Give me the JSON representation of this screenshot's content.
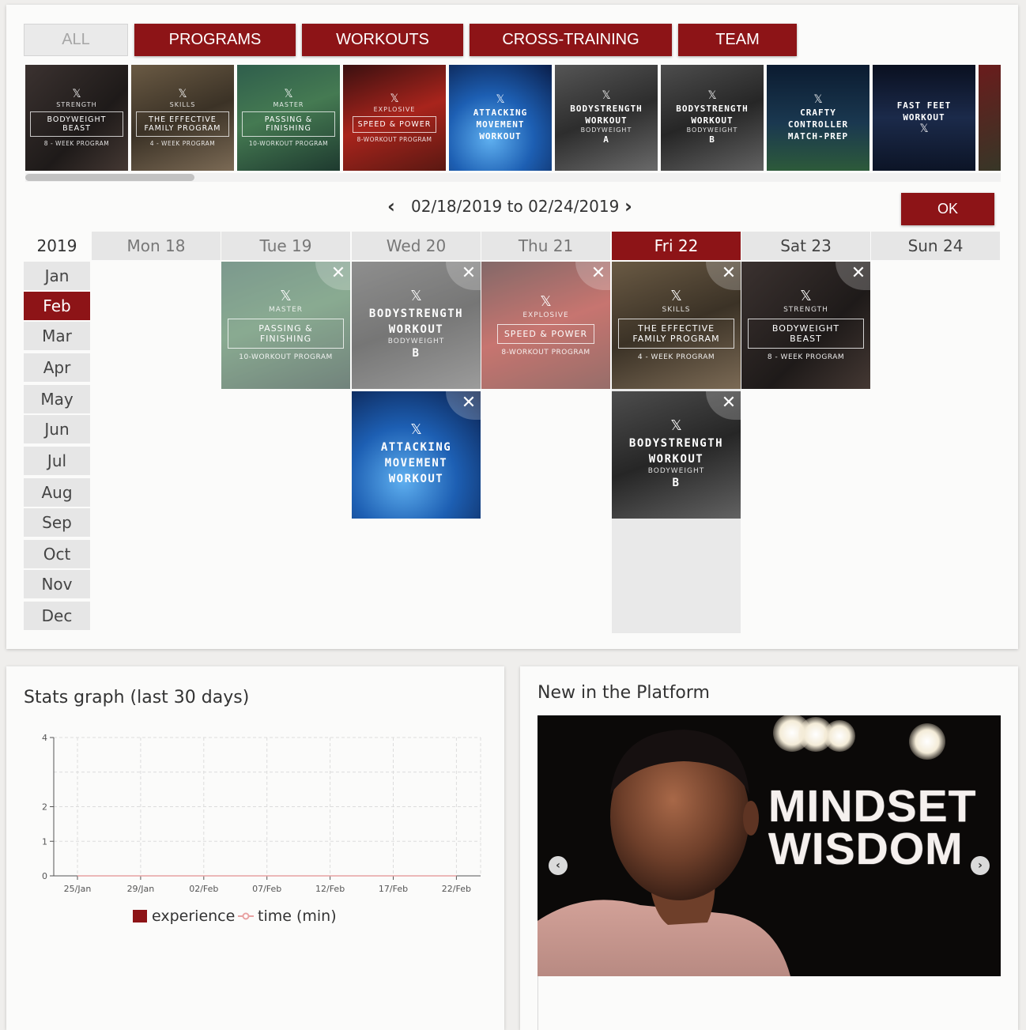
{
  "filters": {
    "all": "ALL",
    "programs": "PROGRAMS",
    "workouts": "WORKOUTS",
    "cross_training": "CROSS-TRAINING",
    "team": "TEAM"
  },
  "carousel": [
    {
      "kicker": "STRENGTH",
      "title": "BODYWEIGHT BEAST",
      "sub": "8 - WEEK PROGRAM"
    },
    {
      "kicker": "SKILLS",
      "title": "THE EFFECTIVE FAMILY PROGRAM",
      "sub": "4 - WEEK PROGRAM"
    },
    {
      "kicker": "MASTER",
      "title": "PASSING & FINISHING",
      "sub": "10-WORKOUT PROGRAM"
    },
    {
      "kicker": "EXPLOSIVE",
      "title": "SPEED & POWER",
      "sub": "8-WORKOUT PROGRAM"
    },
    {
      "title": "ATTACKING MOVEMENT WORKOUT"
    },
    {
      "title": "BODYSTRENGTH WORKOUT",
      "kicker": "BODYWEIGHT",
      "sub": "A"
    },
    {
      "title": "BODYSTRENGTH WORKOUT",
      "kicker": "BODYWEIGHT",
      "sub": "B"
    },
    {
      "title": "CRAFTY CONTROLLER MATCH-PREP"
    },
    {
      "title": "FAST FEET WORKOUT"
    }
  ],
  "week": {
    "range": "02/18/2019 to 02/24/2019",
    "ok": "OK"
  },
  "calendar": {
    "year": "2019",
    "months": [
      "Jan",
      "Feb",
      "Mar",
      "Apr",
      "May",
      "Jun",
      "Jul",
      "Aug",
      "Sep",
      "Oct",
      "Nov",
      "Dec"
    ],
    "active_month": "Feb",
    "days": [
      "Mon 18",
      "Tue 19",
      "Wed 20",
      "Thu 21",
      "Fri 22",
      "Sat 23",
      "Sun 24"
    ],
    "active_day": "Fri 22"
  },
  "schedule": {
    "tue": {
      "kicker": "MASTER",
      "title": "PASSING & FINISHING",
      "sub": "10-WORKOUT PROGRAM"
    },
    "wed1": {
      "title": "BODYSTRENGTH WORKOUT",
      "kicker": "BODYWEIGHT",
      "sub": "B"
    },
    "wed2": {
      "title": "ATTACKING MOVEMENT WORKOUT"
    },
    "thu": {
      "kicker": "EXPLOSIVE",
      "title": "SPEED & POWER",
      "sub": "8-WORKOUT PROGRAM"
    },
    "fri1": {
      "kicker": "SKILLS",
      "title": "THE EFFECTIVE FAMILY PROGRAM",
      "sub": "4 - WEEK PROGRAM"
    },
    "fri2": {
      "title": "BODYSTRENGTH WORKOUT",
      "kicker": "BODYWEIGHT",
      "sub": "B"
    },
    "sat": {
      "kicker": "STRENGTH",
      "title": "BODYWEIGHT BEAST",
      "sub": "8 - WEEK PROGRAM"
    },
    "close_glyph": "✕"
  },
  "stats": {
    "title": "Stats graph (last 30 days)",
    "legend": {
      "experience": "experience",
      "time": "time (min)"
    }
  },
  "chart_data": {
    "type": "line",
    "title": "Stats graph (last 30 days)",
    "x_tick_labels": [
      "25/Jan",
      "29/Jan",
      "02/Feb",
      "07/Feb",
      "12/Feb",
      "17/Feb",
      "22/Feb"
    ],
    "y_ticks": [
      0,
      1,
      2,
      4
    ],
    "ylim": [
      0,
      4
    ],
    "grid": true,
    "legend_position": "bottom",
    "series": [
      {
        "name": "experience",
        "type": "bar",
        "color": "#8d1417",
        "values": [
          0,
          0,
          0,
          0,
          0,
          0,
          0
        ]
      },
      {
        "name": "time (min)",
        "type": "line",
        "color": "#e8a2a2",
        "values": [
          0,
          0,
          0,
          0,
          0,
          0,
          0
        ]
      }
    ]
  },
  "news": {
    "title": "New in the Platform",
    "banner_line1": "MINDSET",
    "banner_line2": "WISDOM",
    "prev_icon": "chevron-left-icon",
    "next_icon": "chevron-right-icon"
  },
  "colors": {
    "accent": "#8d1417",
    "muted_button": "#eaeaea",
    "grid": "#e6e6e6"
  }
}
